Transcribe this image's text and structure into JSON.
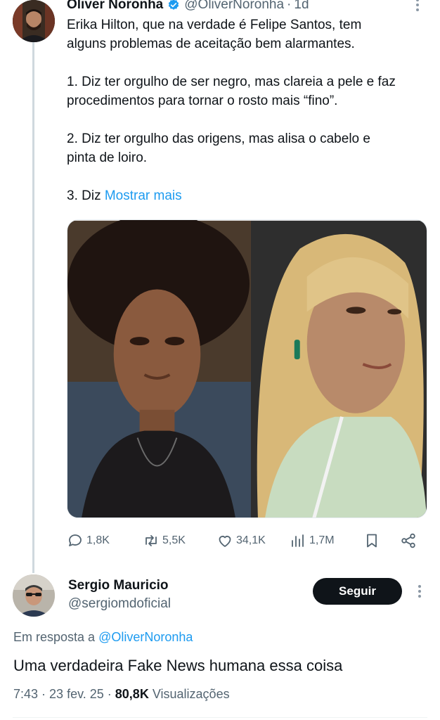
{
  "tweet": {
    "author_name": "Oliver Noronha",
    "author_handle": "@OliverNoronha",
    "separator": "·",
    "time": "1d",
    "text_line1": "Erika Hilton, que na verdade é Felipe Santos, tem",
    "text_line2": "alguns problemas de aceitação bem alarmantes.",
    "point1_line1": "1. Diz ter orgulho de ser negro, mas clareia a pele e faz",
    "point1_line2": "procedimentos para tornar o rosto mais “fino”.",
    "point2_line1": "2. Diz ter orgulho das origens, mas alisa o cabelo e",
    "point2_line2": "pinta de loiro.",
    "point3_prefix": "3. Diz ",
    "show_more": "Mostrar mais",
    "icons": {
      "verified": "verified-badge-icon",
      "more": "more-options-icon"
    },
    "stats": {
      "replies": "1,8K",
      "retweets": "5,5K",
      "likes": "34,1K",
      "views": "1,7M"
    }
  },
  "reply": {
    "author_name": "Sergio Mauricio",
    "author_handle": "@sergiomdoficial",
    "follow_label": "Seguir",
    "in_reply_prefix": "Em resposta a ",
    "in_reply_mention": "@OliverNoronha",
    "text": "Uma verdadeira Fake News humana essa coisa",
    "time": "7:43",
    "date": "23 fev. 25",
    "views_count": "80,8K",
    "views_label": "Visualizações"
  },
  "colors": {
    "accent": "#1d9bf0",
    "text": "#0f1419",
    "secondary": "#536471",
    "follow_button": "#0f1419"
  }
}
